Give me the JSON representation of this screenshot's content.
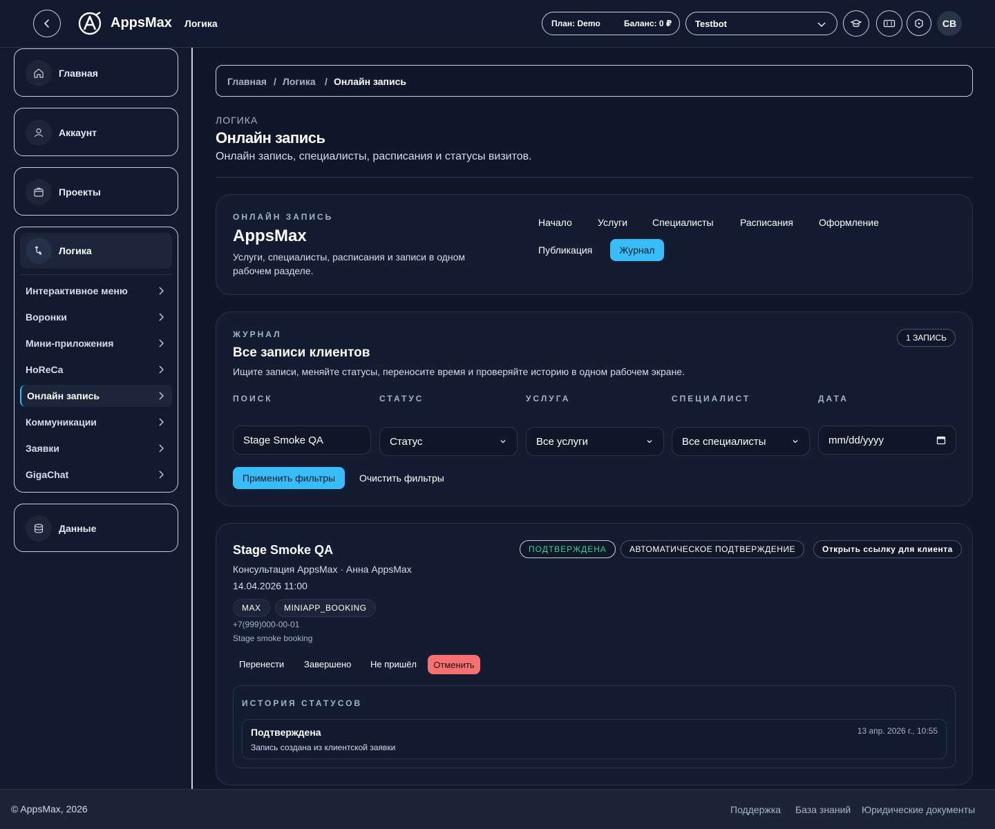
{
  "header": {
    "brand": "AppsMax",
    "section": "Логика",
    "plan": "План: Demo",
    "balance": "Баланс: 0 ₽",
    "bot": "Testbot",
    "avatar": "СВ"
  },
  "sidebar": {
    "top_items": [
      {
        "label": "Главная",
        "icon": "home-icon"
      },
      {
        "label": "Аккаунт",
        "icon": "user-icon"
      },
      {
        "label": "Проекты",
        "icon": "briefcase-icon"
      }
    ],
    "logic": {
      "label": "Логика",
      "items": [
        "Интерактивное меню",
        "Воронки",
        "Мини-приложения",
        "HoReCa",
        "Онлайн запись",
        "Коммуникации",
        "Заявки",
        "GigaChat"
      ],
      "active_index": 4
    },
    "data_item": {
      "label": "Данные",
      "icon": "database-icon"
    }
  },
  "breadcrumb": {
    "items": [
      "Главная",
      "Логика"
    ],
    "current": "Онлайн запись",
    "separator": "/"
  },
  "page": {
    "eyebrow": "ЛОГИКА",
    "title": "Онлайн запись",
    "subtitle": "Онлайн запись, специалисты, расписания и статусы визитов."
  },
  "hero": {
    "eyebrow": "ОНЛАЙН ЗАПИСЬ",
    "title": "AppsMax",
    "desc_line1": "Услуги, специалисты, расписания и записи в одном",
    "desc_line2": "рабочем разделе.",
    "tabs": [
      "Начало",
      "Услуги",
      "Специалисты",
      "Расписания",
      "Оформление",
      "Публикация"
    ],
    "active_tab": "Журнал"
  },
  "journal": {
    "eyebrow": "ЖУРНАЛ",
    "title": "Все записи клиентов",
    "desc": "Ищите записи, меняйте статусы, переносите время и проверяйте историю в одном рабочем экране.",
    "count": "1 ЗАПИСЬ",
    "filters": {
      "search_label": "ПОИСК",
      "search_value": "Stage Smoke QA",
      "status_label": "СТАТУС",
      "status_value": "Статус",
      "service_label": "УСЛУГА",
      "service_value": "Все услуги",
      "specialist_label": "СПЕЦИАЛИСТ",
      "specialist_value": "Все специалисты",
      "date_label": "ДАТА",
      "date_placeholder": "mm/dd/yyyy"
    },
    "apply": "Применить фильтры",
    "clear": "Очистить фильтры"
  },
  "booking": {
    "name": "Stage Smoke QA",
    "service_line": "Консультация AppsMax · Анна AppsMax",
    "datetime": "14.04.2026 11:00",
    "tags": [
      "MAX",
      "MINIAPP_BOOKING"
    ],
    "phone": "+7(999)000-00-01",
    "note": "Stage smoke booking",
    "status": "ПОДТВЕРЖДЕНА",
    "auto": "АВТОМАТИЧЕСКОЕ ПОДТВЕРЖДЕНИЕ",
    "open_link": "Открыть ссылку для клиента",
    "actions": [
      "Перенести",
      "Завершено",
      "Не пришёл"
    ],
    "cancel": "Отменить",
    "status_color": "#34d399",
    "cancel_color": "#f87171",
    "accent": "#38bdf8"
  },
  "history": {
    "eyebrow": "ИСТОРИЯ СТАТУСОВ",
    "items": [
      {
        "title": "Подтверждена",
        "desc": "Запись создана из клиентской заявки",
        "time": "13 апр. 2026 г., 10:55"
      }
    ]
  },
  "footer": {
    "copyright": "© AppsMax, 2026",
    "links": [
      "Поддержка",
      "База знаний",
      "Юридические документы"
    ]
  }
}
